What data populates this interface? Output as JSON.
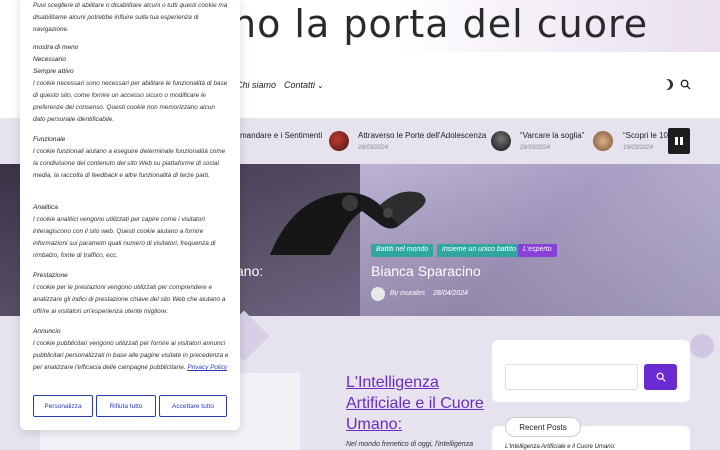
{
  "header": {
    "site_title": "no la porta del cuore",
    "nav": [
      {
        "label": "Chi siamo"
      },
      {
        "label": "Contatti"
      }
    ]
  },
  "ticker": {
    "items": [
      {
        "title": "mandare e i Sentimenti",
        "date": ""
      },
      {
        "title": "Attraverso le Porte dell'Adolescenza",
        "date": "26/03/2024"
      },
      {
        "title": "“Varcare la soglia”",
        "date": "26/03/2024"
      },
      {
        "title": "“Scopri le 10 P",
        "date": "19/03/2024"
      }
    ]
  },
  "hero": {
    "left_title": "ano:",
    "right_title": "Bianca Sparacino",
    "tags": [
      "Battiti nel mondo",
      "Insieme un unico battito",
      "L'esperto"
    ],
    "author": "By murales",
    "date": "28/04/2024"
  },
  "post": {
    "title": "L'Intelligenza Artificiale e il Cuore Umano:",
    "excerpt": "Nel mondo frenetico di oggi, l'intelligenza"
  },
  "sidebar": {
    "search_value": "",
    "recent_label": "Recent Posts",
    "recent_first": "L'Intelligenza Artificiale e il Cuore Umano:"
  },
  "cookie": {
    "intro": "Puoi scegliere di abilitare o disabilitare alcuni o tutti questi cookie ma disabilitarne alcuni potrebbe influire sulla tua esperienza di navigazione.",
    "show_less": "mostra di meno",
    "necessary_title": "Necessario",
    "always_active": "Sempre attivo",
    "necessary_text": "I cookie necessari sono necessari per abilitare le funzionalità di base di questo sito, come fornire un accesso sicuro o modificare le preferenze del consenso. Questi cookie non memorizzano alcun dato personale identificabile.",
    "functional_title": "Funzionale",
    "functional_text": "I cookie funzionali aiutano a eseguire determinate funzionalità come la condivisione del contenuto del sito Web su piattaforme di social media, la raccolta di feedback e altre funzionalità di terze parti.",
    "analytics_title": "Analitica",
    "analytics_text": "I cookie analitici vengono utilizzati per capire come i visitatori interagiscono con il sito web. Questi cookie aiutano a fornire informazioni sui parametri quali numero di visitatori, frequenza di rimbalzo, fonte di traffico, ecc.",
    "performance_title": "Prestazione",
    "performance_text": "I cookie per le prestazioni vengono utilizzati per comprendere e analizzare gli indici di prestazione chiave del sito Web che aiutano a offrire ai visitatori un'esperienza utente migliore.",
    "ads_title": "Annuncio",
    "ads_text": "I cookie pubblicitari vengono utilizzati per fornire ai visitatori annunci pubblicitari personalizzati in base alle pagine visitate in precedenza e per analizzare l'efficacia delle campagne pubblicitarie.",
    "privacy_link": "Privacy Policy",
    "buttons": {
      "customize": "Personalizza",
      "reject": "Rifiuta tutto",
      "accept": "Accettare tutto"
    }
  },
  "colors": {
    "accent": "#6a2bd1",
    "tag_teal": "#2fa6a0",
    "tag_purple": "#8a3fd6",
    "link_blue": "#2b3bb0"
  }
}
